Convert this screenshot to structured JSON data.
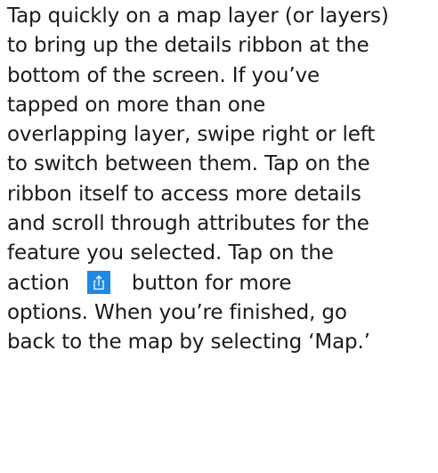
{
  "paragraph": {
    "lines": [
      "Tap quickly on a map layer (or layers)",
      "to bring up the details ribbon at the",
      "bottom of the screen. If you’ve",
      "tapped on more than one",
      "overlapping layer, swipe right or left",
      "to switch between them. Tap on the",
      "ribbon itself to access more details",
      "and scroll through attributes for the",
      "feature you selected. Tap on the"
    ],
    "action_line_before": "action",
    "action_line_after": "button for more",
    "line_after_action_1": "options. When you’re finished, go",
    "line_after_action_2": "back to the map by selecting ‘Map.’"
  },
  "icons": {
    "action_button_icon": "share-icon",
    "action_button_color": "#1e88e5"
  }
}
